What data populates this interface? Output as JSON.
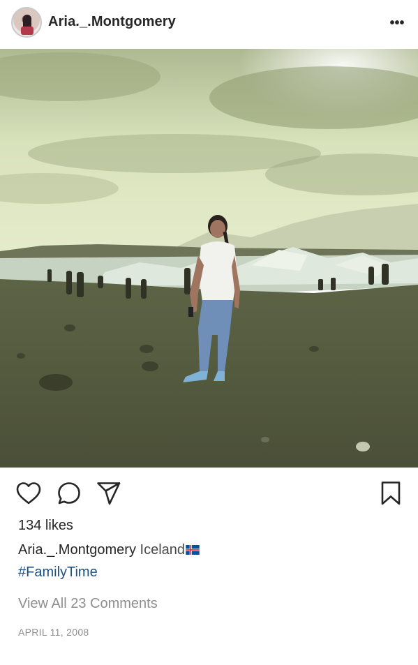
{
  "post": {
    "username": "Aria._.Montgomery",
    "more_label": "•••",
    "likes_text": "134 likes",
    "caption_user": "Aria._.Montgomery",
    "caption_text": "Iceland",
    "hashtag": "#FamilyTime",
    "view_comments": "View All 23 Comments",
    "date": "APRIL 11, 2008"
  },
  "icons": {
    "avatar": "avatar",
    "more": "more-options-icon",
    "like": "heart-icon",
    "comment": "comment-icon",
    "share": "paper-plane-icon",
    "save": "bookmark-icon",
    "flag": "iceland-flag-icon"
  },
  "colors": {
    "text": "#262626",
    "muted": "#8e8e8e",
    "hashtag": "#1f4f7f",
    "flag_blue": "#02529C",
    "flag_red": "#DC1E35"
  }
}
